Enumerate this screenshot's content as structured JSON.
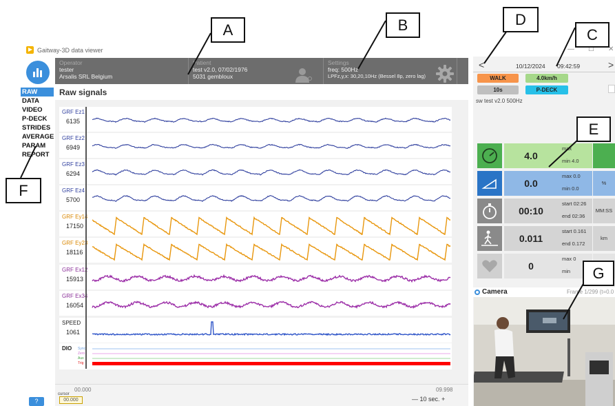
{
  "window": {
    "title": "Gaitway-3D data viewer"
  },
  "nav": {
    "items": [
      {
        "label": "RAW",
        "active": true
      },
      {
        "label": "DATA"
      },
      {
        "label": "VIDEO"
      },
      {
        "label": "P-DECK"
      },
      {
        "label": "STRIDES"
      },
      {
        "label": "AVERAGE"
      },
      {
        "label": "PARAM"
      },
      {
        "label": "REPORT"
      }
    ],
    "help_label": "?"
  },
  "header": {
    "operator": {
      "caption": "Operator",
      "line1": "tester",
      "line2": "Arsalis SRL Belgium"
    },
    "patient": {
      "caption": "Patient",
      "line1": "test v2.0, 07/02/1976",
      "line2": "5031 gembloux"
    },
    "settings": {
      "caption": "Settings",
      "line1": "freq: 500Hz",
      "line2": "LPFz,y,x: 30,20,10Hz (Bessel 8p, zero lag)"
    }
  },
  "main": {
    "title": "Raw signals",
    "rows": [
      {
        "name": "GRF Ez1",
        "value": "6135",
        "color": "#2f3f9e"
      },
      {
        "name": "GRF Ez2",
        "value": "6949",
        "color": "#2f3f9e"
      },
      {
        "name": "GRF Ez3",
        "value": "6294",
        "color": "#2f3f9e"
      },
      {
        "name": "GRF Ez4",
        "value": "5700",
        "color": "#2f3f9e"
      },
      {
        "name": "GRF Ey14",
        "value": "17150",
        "color": "#e8960c"
      },
      {
        "name": "GRF Ey23",
        "value": "18116",
        "color": "#e8960c"
      },
      {
        "name": "GRF Ex12",
        "value": "15913",
        "color": "#9c2fa8"
      },
      {
        "name": "GRF Ex34",
        "value": "16054",
        "color": "#9c2fa8"
      },
      {
        "name": "SPEED",
        "value": "1061",
        "color": "#2f55c8"
      }
    ],
    "dio": {
      "name": "DIO",
      "channels": [
        "Sync",
        "Zero",
        "Aux",
        "Trig"
      ]
    },
    "bottom": {
      "t_start": "00.000",
      "t_end": "09.998",
      "cursor_caption": "cursor",
      "cursor_value": "00.000",
      "window_label": "—  10 sec.  +"
    }
  },
  "right": {
    "date": "10/12/2024",
    "time": "09:42:59",
    "prev_label": "<",
    "next_label": ">",
    "chips": {
      "walk": "WALK",
      "speed": "4.0km/h",
      "duration": "10s",
      "pdeck": "P-DECK"
    },
    "test_info": "sw test v2.0 500Hz",
    "metrics": [
      {
        "value": "4.0",
        "sub1": "max",
        "sub2": "min  4.0",
        "unit": ""
      },
      {
        "value": "0.0",
        "sub1": "max  0.0",
        "sub2": "min  0.0",
        "unit": "%"
      },
      {
        "value": "00:10",
        "sub1": "start  02:26",
        "sub2": "end  02:36",
        "unit": "MM:SS"
      },
      {
        "value": "0.011",
        "sub1": "start  0.161",
        "sub2": "end  0.172",
        "unit": "km"
      },
      {
        "value": "0",
        "sub1": "max  0",
        "sub2": "min",
        "unit": ""
      }
    ],
    "camera": {
      "label": "Camera",
      "frame_info": "Frame 1/299 (t=0.0"
    }
  },
  "callouts": [
    "A",
    "B",
    "C",
    "D",
    "E",
    "F",
    "G"
  ],
  "colors": {
    "accent": "#3b8fdc",
    "header_bg": "#6d6d6d",
    "trig": "#ff0000"
  }
}
